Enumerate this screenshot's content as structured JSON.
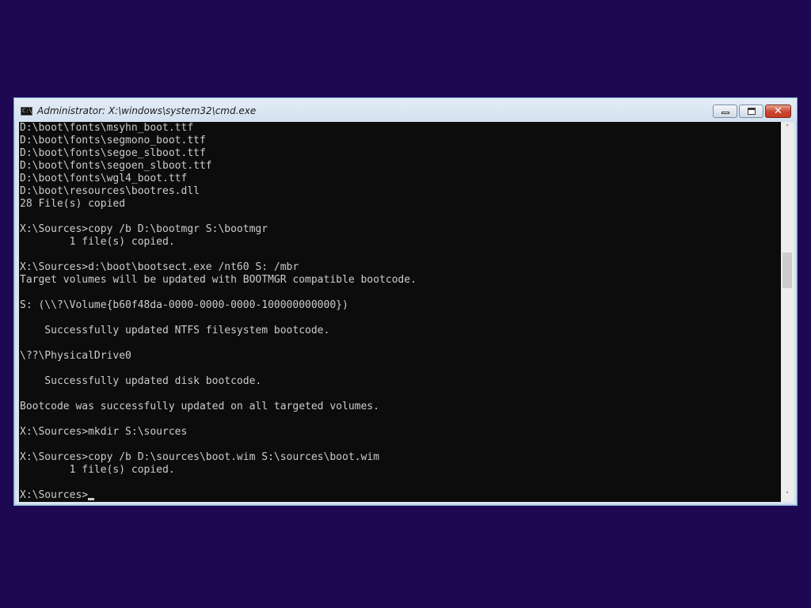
{
  "window": {
    "title": "Administrator: X:\\windows\\system32\\cmd.exe",
    "icon": "cmd-console-icon",
    "icon_label": "C:\\",
    "controls": {
      "minimize": "minimize-icon",
      "maximize": "maximize-icon",
      "close": "close-icon",
      "close_glyph": "✕"
    }
  },
  "console": {
    "lines": [
      "D:\\boot\\fonts\\msyhn_boot.ttf",
      "D:\\boot\\fonts\\segmono_boot.ttf",
      "D:\\boot\\fonts\\segoe_slboot.ttf",
      "D:\\boot\\fonts\\segoen_slboot.ttf",
      "D:\\boot\\fonts\\wgl4_boot.ttf",
      "D:\\boot\\resources\\bootres.dll",
      "28 File(s) copied",
      "",
      "X:\\Sources>copy /b D:\\bootmgr S:\\bootmgr",
      "        1 file(s) copied.",
      "",
      "X:\\Sources>d:\\boot\\bootsect.exe /nt60 S: /mbr",
      "Target volumes will be updated with BOOTMGR compatible bootcode.",
      "",
      "S: (\\\\?\\Volume{b60f48da-0000-0000-0000-100000000000})",
      "",
      "    Successfully updated NTFS filesystem bootcode.",
      "",
      "\\??\\PhysicalDrive0",
      "",
      "    Successfully updated disk bootcode.",
      "",
      "Bootcode was successfully updated on all targeted volumes.",
      "",
      "X:\\Sources>mkdir S:\\sources",
      "",
      "X:\\Sources>copy /b D:\\sources\\boot.wim S:\\sources\\boot.wim",
      "        1 file(s) copied.",
      ""
    ],
    "prompt": "X:\\Sources>"
  },
  "scrollbar": {
    "up_arrow": "˄",
    "down_arrow": "˅",
    "position": 0.37
  },
  "colors": {
    "desktop": "#1e0753",
    "console_bg": "#0c0c0c",
    "console_fg": "#cccccc",
    "close_button": "#c8472e"
  }
}
